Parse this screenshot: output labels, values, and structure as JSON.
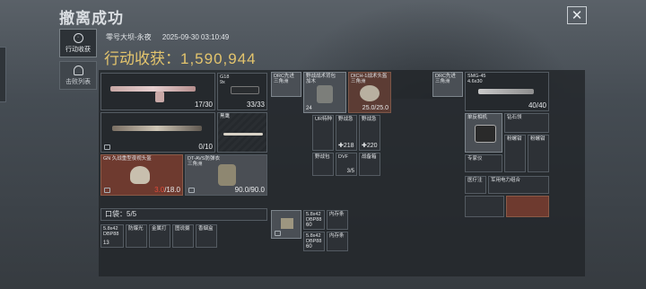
{
  "title": "撤离成功",
  "close_icon": "close-icon",
  "nav": [
    {
      "label": "行动收获",
      "icon": "target-icon",
      "active": true
    },
    {
      "label": "击败列表",
      "icon": "person-icon",
      "active": false
    }
  ],
  "header": {
    "map": "零号大坝-永夜",
    "datetime": "2025-09-30 03:10:49",
    "income_label": "行动收获：",
    "income_value": "1,590,944"
  },
  "loadout": {
    "primary_weapon": {
      "count": "17/30"
    },
    "pistol": {
      "name": "G18",
      "sub": "9x",
      "count": "33/33"
    },
    "secondary_weapon": {
      "count": "0/10"
    },
    "melee": {
      "name": "黑鹰"
    },
    "helmet": {
      "name": "GN 久战重型夜视头盔",
      "current": "3.0",
      "max": "18.0"
    },
    "armor": {
      "name": "DT-AVS防弹衣",
      "sub": "三角洲",
      "count": "90.0/90.0"
    }
  },
  "rig": {
    "items": [
      {
        "name": "DRC先进",
        "sub": "三角洲"
      },
      {
        "name": "野战战术背包",
        "sub": "加木",
        "count": "24"
      },
      {
        "name": "DICH-1战术头盔",
        "sub": "三角洲",
        "count": "25.0/25.0"
      },
      {
        "name": "UR特种"
      },
      {
        "name": "野战急"
      },
      {
        "name": "野战急"
      },
      {
        "count_a": "218",
        "count_b": "220"
      },
      {
        "name": "野战包"
      },
      {
        "name": "DVF",
        "count": "3/5"
      },
      {
        "name": "战备箱"
      }
    ]
  },
  "pocket": {
    "label": "口袋：",
    "value": "5/5",
    "items": [
      {
        "name": "5.8x42",
        "sub": "DBP88",
        "count": "13"
      },
      {
        "name": "防爆光"
      },
      {
        "name": "金属打"
      },
      {
        "name": "图说摄"
      },
      {
        "name": "香烟盒"
      }
    ]
  },
  "safe_box": {
    "items": [
      {
        "name": "5.8x42",
        "sub": "DBP88",
        "count": "60"
      },
      {
        "name": "内存条"
      },
      {
        "name": "5.8x42",
        "sub": "DBP88",
        "count": "60"
      },
      {
        "name": "内存条"
      }
    ]
  },
  "backpack": {
    "items": [
      {
        "name": "DRC先进",
        "sub": "三角洲"
      },
      {
        "name": "SMG-45",
        "sub": "4.6x30",
        "count": "40/40"
      },
      {
        "name": "单反相机"
      },
      {
        "name": "钻石领"
      },
      {
        "name": "专家仪"
      },
      {
        "name": "粉螺钳"
      },
      {
        "name": "粉螺钳"
      },
      {
        "name": "医疗注"
      },
      {
        "name": "军用电力组合"
      }
    ]
  }
}
